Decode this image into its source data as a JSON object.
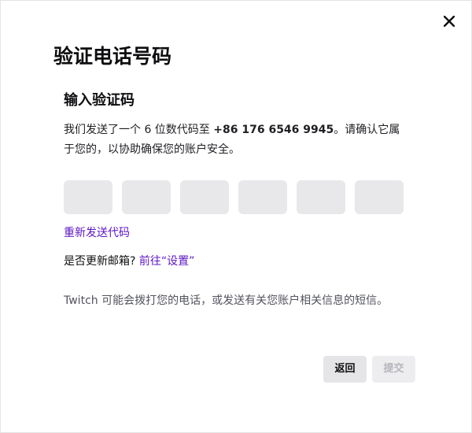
{
  "dialog": {
    "close_icon": "close-icon",
    "title": "验证电话号码",
    "subtitle": "输入验证码",
    "description_prefix": "我们发送了一个 6 位数代码至 ",
    "phone_number": "+86 176 6546 9945",
    "description_suffix": "。请确认它属于您的，以协助确保您的账户安全。",
    "code_inputs": [
      {
        "value": "",
        "placeholder": ""
      },
      {
        "value": "",
        "placeholder": ""
      },
      {
        "value": "",
        "placeholder": ""
      },
      {
        "value": "",
        "placeholder": ""
      },
      {
        "value": "",
        "placeholder": ""
      },
      {
        "value": "",
        "placeholder": ""
      }
    ],
    "resend_link": "重新发送代码",
    "update_email_question": "是否更新邮箱? ",
    "settings_link": "前往“设置”",
    "notice": "Twitch 可能会拨打您的电话，或发送有关您账户相关信息的短信。",
    "back_button": "返回",
    "submit_button": "提交",
    "submit_disabled": true
  },
  "colors": {
    "link": "#5c16c5",
    "input_bg": "#e8e8ea",
    "button_bg": "#e5e5e7",
    "disabled_text": "#b5b5bb"
  }
}
